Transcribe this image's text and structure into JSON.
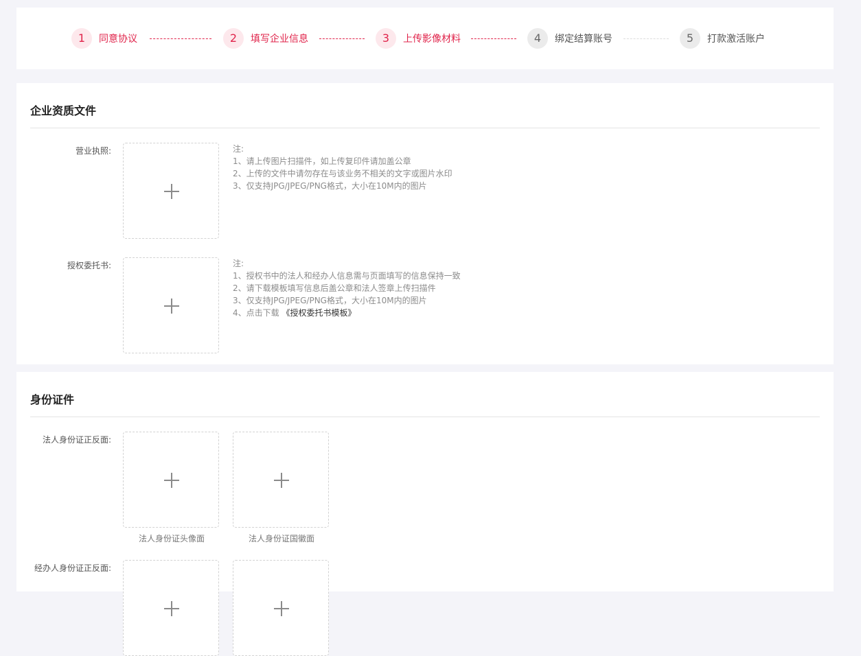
{
  "steps": [
    {
      "num": "1",
      "label": "同意协议"
    },
    {
      "num": "2",
      "label": "填写企业信息"
    },
    {
      "num": "3",
      "label": "上传影像材料"
    },
    {
      "num": "4",
      "label": "绑定结算账号"
    },
    {
      "num": "5",
      "label": "打款激活账户"
    }
  ],
  "colors": {
    "accent": "#e0244b",
    "accent_bg": "#fde8ec",
    "pending_bg": "#ebebeb"
  },
  "qualification": {
    "title": "企业资质文件",
    "business_license": {
      "label": "营业执照:",
      "notes": [
        "注:",
        "1、请上传图片扫描件，如上传复印件请加盖公章",
        "2、上传的文件中请勿存在与该业务不相关的文字或图片水印",
        "3、仅支持JPG/JPEG/PNG格式，大小在10M内的图片"
      ]
    },
    "authorization": {
      "label": "授权委托书:",
      "notes": [
        "注:",
        "1、授权书中的法人和经办人信息需与页面填写的信息保持一致",
        "2、请下载模板填写信息后盖公章和法人签章上传扫描件",
        "3、仅支持JPG/JPEG/PNG格式，大小在10M内的图片"
      ],
      "note4_prefix": "4、点击下载",
      "template_link": "《授权委托书模板》"
    }
  },
  "identity": {
    "title": "身份证件",
    "legal_rep": {
      "label": "法人身份证正反面:",
      "front_caption": "法人身份证头像面",
      "back_caption": "法人身份证国徽面"
    },
    "agent": {
      "label": "经办人身份证正反面:"
    }
  },
  "icons": {
    "upload": "plus-icon"
  }
}
